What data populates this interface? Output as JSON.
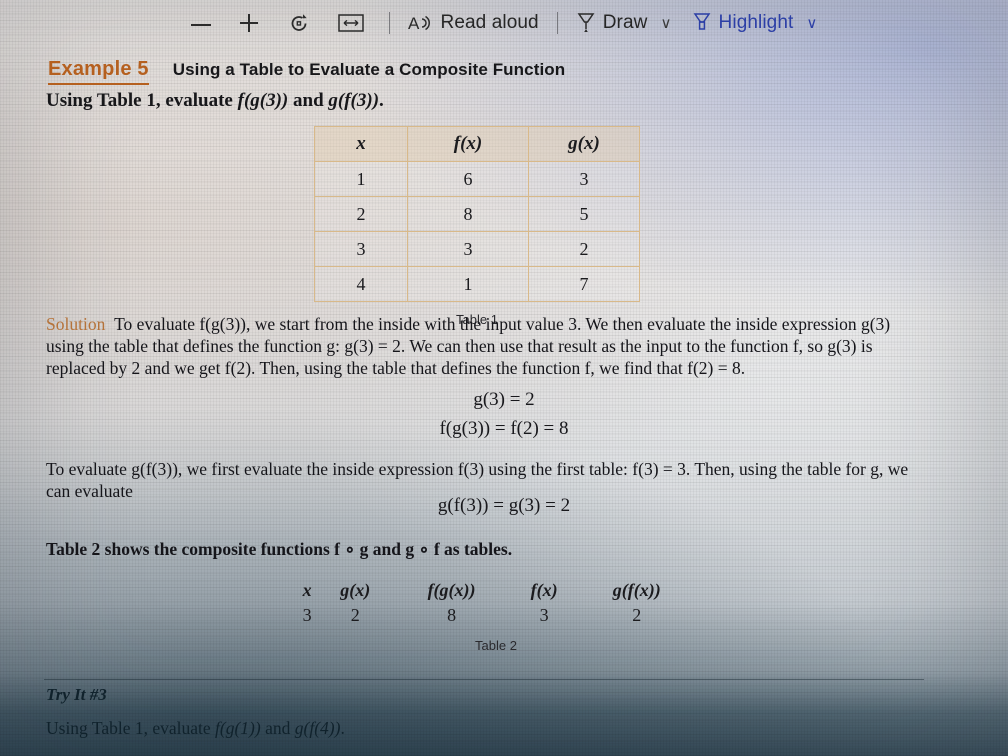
{
  "toolbar": {
    "zoom_out_label": "",
    "zoom_in_label": "",
    "rotate_label": "",
    "fit_label": "",
    "read_aloud_label": "Read aloud",
    "draw_label": "Draw",
    "highlight_label": "Highlight",
    "chevron": "∨",
    "icons": {
      "zoom_out": "minus-icon",
      "zoom_in": "plus-icon",
      "rotate": "rotate-clockwise-icon",
      "fit_page": "fit-to-width-icon",
      "read_aloud": "read-aloud-icon",
      "draw": "pen-icon",
      "highlight": "highlighter-icon"
    },
    "highlight_color": "#2c3fa6",
    "accent_color": "#b5601f"
  },
  "example": {
    "label": "Example 5",
    "title": "Using a Table to Evaluate a Composite Function",
    "instruction_prefix": "Using Table 1, evaluate ",
    "instruction_expr1": "f(g(3))",
    "instruction_mid": " and ",
    "instruction_expr2": "g(f(3))",
    "instruction_suffix": "."
  },
  "table1": {
    "caption": "Table 1",
    "headers": [
      "x",
      "f(x)",
      "g(x)"
    ],
    "rows": [
      [
        "1",
        "6",
        "3"
      ],
      [
        "2",
        "8",
        "5"
      ],
      [
        "3",
        "3",
        "2"
      ],
      [
        "4",
        "1",
        "7"
      ]
    ]
  },
  "solution": {
    "label": "Solution",
    "paragraph1": "To evaluate f(g(3)), we start from the inside with the input value 3. We then evaluate the inside expression g(3) using the table that defines the function g: g(3) = 2. We can then use that result as the input to the function f, so g(3) is replaced by 2 and we get f(2). Then, using the table that defines the function f, we find that f(2) = 8.",
    "equation1": "g(3) = 2",
    "equation2": "f(g(3)) = f(2) = 8",
    "paragraph2": "To evaluate g(f(3)), we first evaluate the inside expression f(3) using the first table: f(3) = 3. Then, using the table for g, we can evaluate",
    "equation3": "g(f(3)) = g(3) = 2",
    "paragraph3": "Table 2 shows the composite functions f ∘ g and g ∘ f as tables."
  },
  "table2": {
    "caption": "Table 2",
    "headers": [
      "x",
      "g(x)",
      "f(g(x))",
      "f(x)",
      "g(f(x))"
    ],
    "rows": [
      [
        "3",
        "2",
        "8",
        "3",
        "2"
      ]
    ]
  },
  "try_it": {
    "label": "Try It #3",
    "text_prefix": "Using Table 1, evaluate ",
    "expr1": "f(g(1))",
    "mid": " and ",
    "expr2": "g(f(4))",
    "suffix": "."
  }
}
